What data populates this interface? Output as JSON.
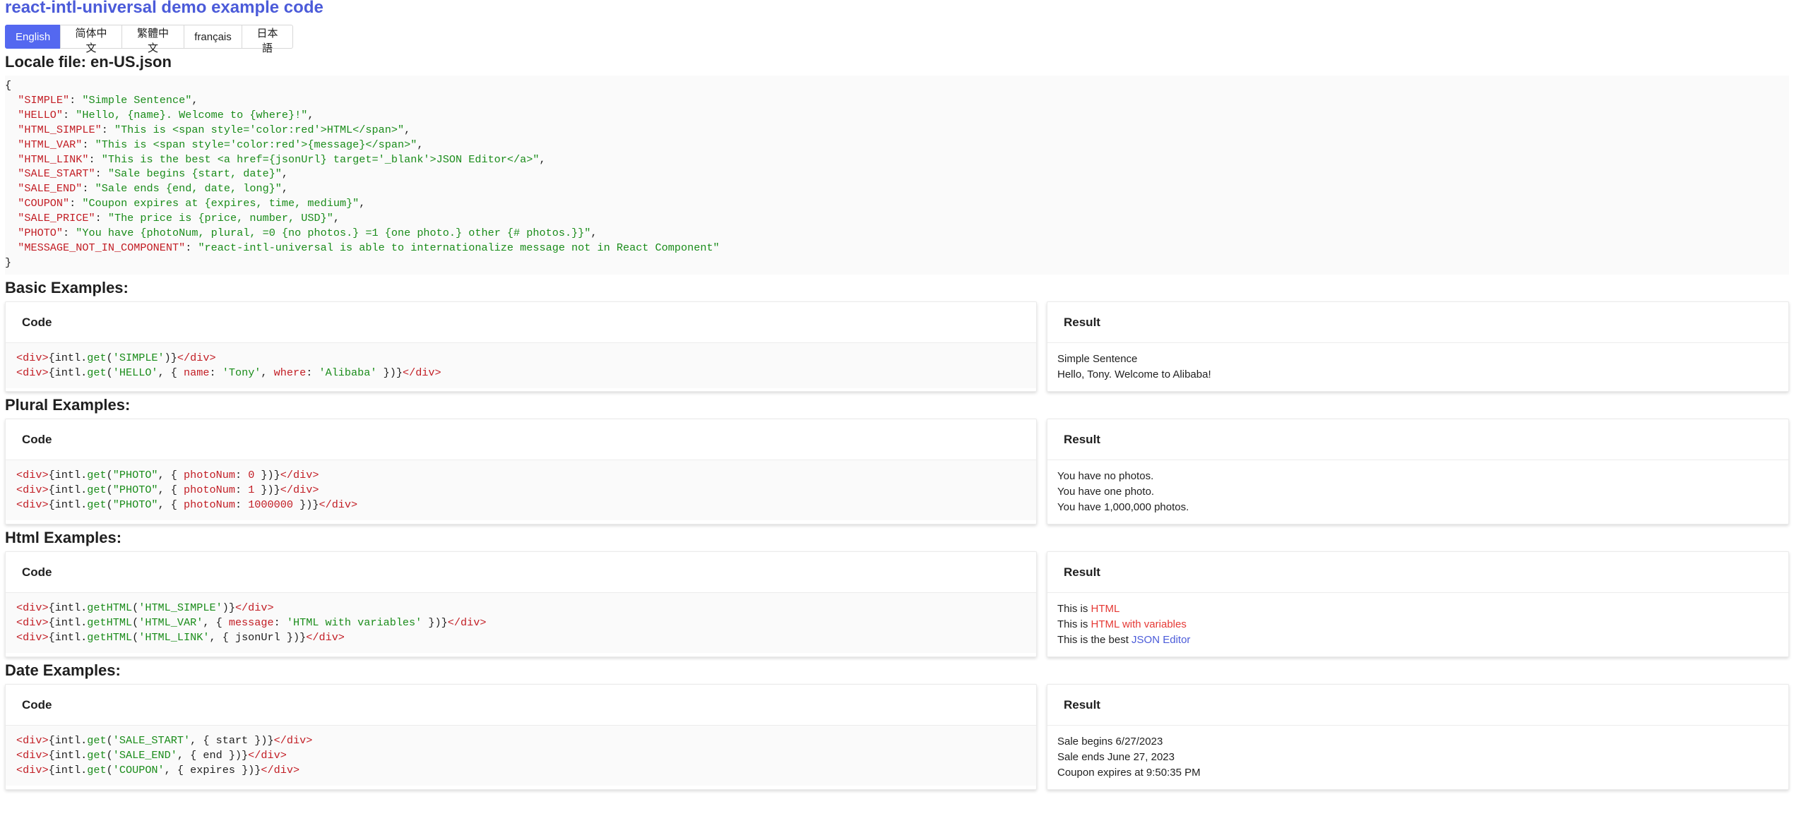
{
  "title": "react-intl-universal demo example code",
  "languages": [
    "English",
    "简体中文",
    "繁體中文",
    "français",
    "日本語"
  ],
  "active_language": "English",
  "locale_heading": "Locale file: en-US.json",
  "locale": {
    "open": "{",
    "close": "}",
    "entries": [
      {
        "key": "\"SIMPLE\"",
        "value": "\"Simple Sentence\""
      },
      {
        "key": "\"HELLO\"",
        "value": "\"Hello, {name}. Welcome to {where}!\""
      },
      {
        "key": "\"HTML_SIMPLE\"",
        "value": "\"This is <span style='color:red'>HTML</span>\""
      },
      {
        "key": "\"HTML_VAR\"",
        "value": "\"This is <span style='color:red'>{message}</span>\""
      },
      {
        "key": "\"HTML_LINK\"",
        "value": "\"This is the best <a href={jsonUrl} target='_blank'>JSON Editor</a>\""
      },
      {
        "key": "\"SALE_START\"",
        "value": "\"Sale begins {start, date}\""
      },
      {
        "key": "\"SALE_END\"",
        "value": "\"Sale ends {end, date, long}\""
      },
      {
        "key": "\"COUPON\"",
        "value": "\"Coupon expires at {expires, time, medium}\""
      },
      {
        "key": "\"SALE_PRICE\"",
        "value": "\"The price is {price, number, USD}\""
      },
      {
        "key": "\"PHOTO\"",
        "value": "\"You have {photoNum, plural, =0 {no photos.} =1 {one photo.} other {# photos.}}\""
      },
      {
        "key": "\"MESSAGE_NOT_IN_COMPONENT\"",
        "value": "\"react-intl-universal is able to internationalize message not in React Component\""
      }
    ]
  },
  "card_labels": {
    "code": "Code",
    "result": "Result"
  },
  "code_tokens": {
    "tag_open": "<div>",
    "tag_close": "</div>",
    "intl": "{intl",
    "dot": ".",
    "get": "get",
    "getHTML": "getHTML",
    "paren_close_brace": ")}",
    "brace_close": " })}",
    "open_obj": ", { "
  },
  "basic": {
    "heading": "Basic Examples:",
    "lines": [
      {
        "arg": "'SIMPLE'"
      },
      {
        "arg": "'HELLO'",
        "k1": "name",
        "v1": "'Tony'",
        "k2": "where",
        "v2": "'Alibaba'"
      }
    ],
    "results": [
      "Simple Sentence",
      "Hello, Tony. Welcome to Alibaba!"
    ]
  },
  "plural": {
    "heading": "Plural Examples:",
    "lines": [
      {
        "arg": "\"PHOTO\"",
        "key": "photoNum",
        "num": "0"
      },
      {
        "arg": "\"PHOTO\"",
        "key": "photoNum",
        "num": "1"
      },
      {
        "arg": "\"PHOTO\"",
        "key": "photoNum",
        "num": "1000000"
      }
    ],
    "results": [
      "You have no photos.",
      "You have one photo.",
      "You have 1,000,000 photos."
    ]
  },
  "html": {
    "heading": "Html Examples:",
    "lines": [
      {
        "arg": "'HTML_SIMPLE'"
      },
      {
        "arg": "'HTML_VAR'",
        "key": "message",
        "val": "'HTML with variables'"
      },
      {
        "arg": "'HTML_LINK'",
        "plain": "jsonUrl"
      }
    ],
    "results": [
      {
        "prefix": "This is ",
        "highlight": "HTML"
      },
      {
        "prefix": "This is ",
        "highlight": "HTML with variables"
      },
      {
        "prefix": "This is the best ",
        "link": "JSON Editor"
      }
    ]
  },
  "date": {
    "heading": "Date Examples:",
    "lines": [
      {
        "arg": "'SALE_START'",
        "plain": "start"
      },
      {
        "arg": "'SALE_END'",
        "plain": "end"
      },
      {
        "arg": "'COUPON'",
        "plain": "expires"
      }
    ],
    "results": [
      "Sale begins 6/27/2023",
      "Sale ends June 27, 2023",
      "Coupon expires at 9:50:35 PM"
    ]
  },
  "colors": {
    "accent": "#5468f0",
    "title": "#4b5bd9",
    "key": "#c21d24",
    "string": "#1a8c1a",
    "highlight": "#e53935"
  }
}
